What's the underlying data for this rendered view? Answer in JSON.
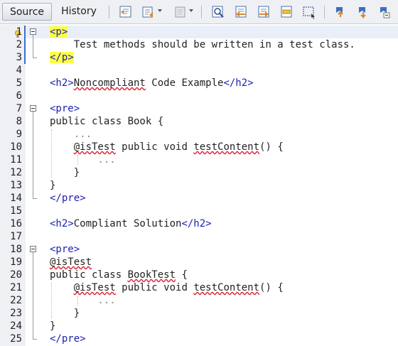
{
  "tabs": [
    {
      "label": "Source",
      "active": true
    },
    {
      "label": "History",
      "active": false
    }
  ],
  "toolbar_icons": [
    "last-edit-icon",
    "back-icon",
    "forward-icon",
    "find-icon",
    "find-previous-icon",
    "find-next-icon",
    "toggle-highlight-icon",
    "toggle-rectangular-selection-icon",
    "previous-bookmark-icon",
    "next-bookmark-icon",
    "toggle-bookmark-icon"
  ],
  "lines": [
    {
      "n": "1",
      "parts": [
        {
          "t": "<p>",
          "c": "tag tag-hl"
        }
      ]
    },
    {
      "n": "2",
      "parts": [
        {
          "t": "    Test methods should be written in a test class.",
          "c": ""
        }
      ]
    },
    {
      "n": "3",
      "parts": [
        {
          "t": "</p>",
          "c": "tag tag-hl"
        }
      ]
    },
    {
      "n": "4",
      "parts": []
    },
    {
      "n": "5",
      "parts": [
        {
          "t": "<h2>",
          "c": "tag"
        },
        {
          "t": "Noncompliant",
          "c": "squig"
        },
        {
          "t": " Code Example",
          "c": ""
        },
        {
          "t": "</h2>",
          "c": "tag"
        }
      ]
    },
    {
      "n": "6",
      "parts": []
    },
    {
      "n": "7",
      "parts": [
        {
          "t": "<pre>",
          "c": "tag"
        }
      ]
    },
    {
      "n": "8",
      "parts": [
        {
          "t": "public class Book {",
          "c": ""
        }
      ]
    },
    {
      "n": "9",
      "parts": [
        {
          "t": "    ...",
          "c": "dots"
        }
      ]
    },
    {
      "n": "10",
      "parts": [
        {
          "t": "    ",
          "c": ""
        },
        {
          "t": "@isTest",
          "c": "squig"
        },
        {
          "t": " public void ",
          "c": ""
        },
        {
          "t": "testContent",
          "c": "squig"
        },
        {
          "t": "() {",
          "c": ""
        }
      ]
    },
    {
      "n": "11",
      "parts": [
        {
          "t": "        ...",
          "c": "dots"
        }
      ]
    },
    {
      "n": "12",
      "parts": [
        {
          "t": "    }",
          "c": ""
        }
      ]
    },
    {
      "n": "13",
      "parts": [
        {
          "t": "}",
          "c": ""
        }
      ]
    },
    {
      "n": "14",
      "parts": [
        {
          "t": "</pre>",
          "c": "tag"
        }
      ]
    },
    {
      "n": "15",
      "parts": []
    },
    {
      "n": "16",
      "parts": [
        {
          "t": "<h2>",
          "c": "tag"
        },
        {
          "t": "Compliant Solution",
          "c": ""
        },
        {
          "t": "</h2>",
          "c": "tag"
        }
      ]
    },
    {
      "n": "17",
      "parts": []
    },
    {
      "n": "18",
      "parts": [
        {
          "t": "<pre>",
          "c": "tag"
        }
      ]
    },
    {
      "n": "19",
      "parts": [
        {
          "t": "@isTest",
          "c": "squig"
        }
      ]
    },
    {
      "n": "20",
      "parts": [
        {
          "t": "public class ",
          "c": ""
        },
        {
          "t": "BookTest",
          "c": "squig"
        },
        {
          "t": " {",
          "c": ""
        }
      ]
    },
    {
      "n": "21",
      "parts": [
        {
          "t": "    ",
          "c": ""
        },
        {
          "t": "@isTest",
          "c": "squig"
        },
        {
          "t": " public void ",
          "c": ""
        },
        {
          "t": "testContent",
          "c": "squig"
        },
        {
          "t": "() {",
          "c": ""
        }
      ]
    },
    {
      "n": "22",
      "parts": [
        {
          "t": "        ...",
          "c": "dots"
        }
      ]
    },
    {
      "n": "23",
      "parts": [
        {
          "t": "    }",
          "c": ""
        }
      ]
    },
    {
      "n": "24",
      "parts": [
        {
          "t": "}",
          "c": ""
        }
      ]
    },
    {
      "n": "25",
      "parts": [
        {
          "t": "</pre>",
          "c": "tag"
        }
      ]
    }
  ]
}
